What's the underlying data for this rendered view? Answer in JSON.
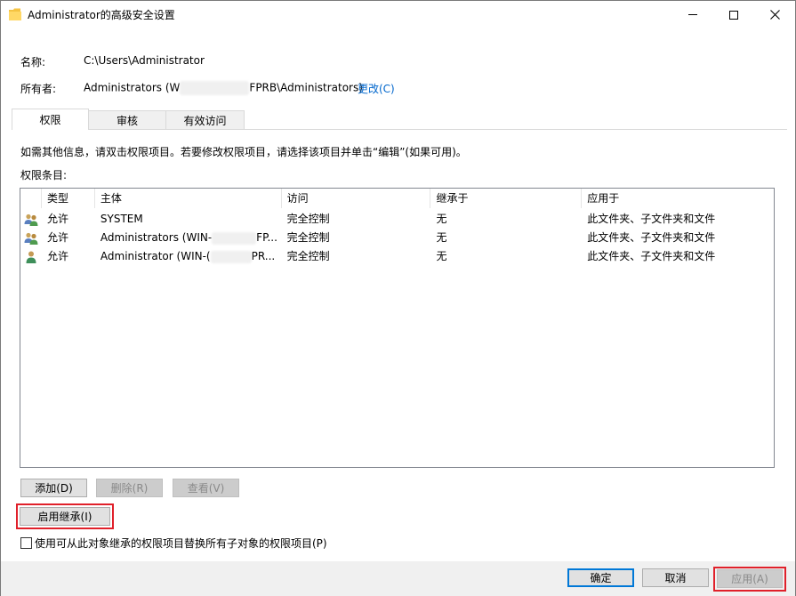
{
  "window": {
    "title": "Administrator的高级安全设置"
  },
  "info": {
    "name_label": "名称:",
    "name_value": "C:\\Users\\Administrator",
    "owner_label": "所有者:",
    "owner_prefix": "Administrators (W",
    "owner_suffix": "FPRB\\Administrators)",
    "change_link": "更改(C)"
  },
  "tabs": [
    {
      "label": "权限",
      "active": true
    },
    {
      "label": "审核",
      "active": false
    },
    {
      "label": "有效访问",
      "active": false
    }
  ],
  "permissions": {
    "info_text": "如需其他信息，请双击权限项目。若要修改权限项目，请选择该项目并单击“编辑”(如果可用)。",
    "entries_label": "权限条目:",
    "columns": [
      "类型",
      "主体",
      "访问",
      "继承于",
      "应用于"
    ],
    "rows": [
      {
        "icon": "group-icon",
        "type": "允许",
        "principal": "SYSTEM",
        "access": "完全控制",
        "inherited": "无",
        "applies": "此文件夹、子文件夹和文件"
      },
      {
        "icon": "group-icon",
        "type": "允许",
        "principal": "Administrators (WIN-",
        "principal_suffix": "FP...",
        "access": "完全控制",
        "inherited": "无",
        "applies": "此文件夹、子文件夹和文件"
      },
      {
        "icon": "user-icon",
        "type": "允许",
        "principal": "Administrator (WIN-(",
        "principal_suffix": "PR...",
        "access": "完全控制",
        "inherited": "无",
        "applies": "此文件夹、子文件夹和文件"
      }
    ]
  },
  "buttons": {
    "add": "添加(D)",
    "remove": "删除(R)",
    "view": "查看(V)",
    "enable_inheritance": "启用继承(I)",
    "replace_checkbox": "使用可从此对象继承的权限项目替换所有子对象的权限项目(P)",
    "ok": "确定",
    "cancel": "取消",
    "apply": "应用(A)"
  },
  "colors": {
    "highlight": "#e0202a",
    "link": "#0066cc",
    "default_button": "#0078d7"
  }
}
